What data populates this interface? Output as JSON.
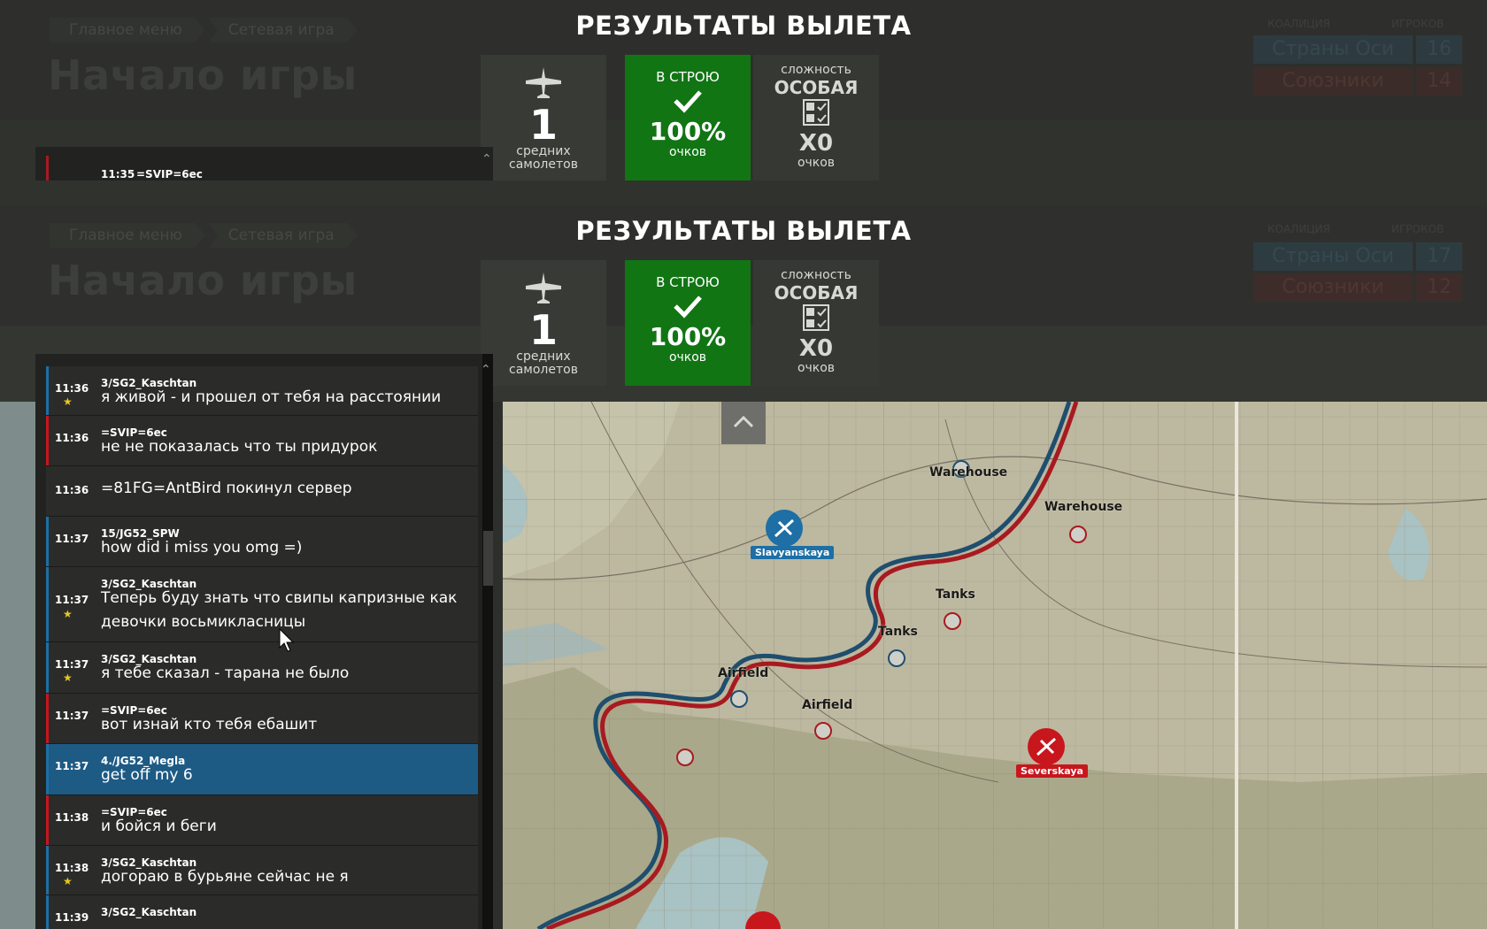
{
  "header": {
    "breadcrumbs": [
      "Главное меню",
      "Сетевая игра"
    ],
    "page_title": "Начало игры",
    "coalition_header": "КОАЛИЦИЯ",
    "players_header": "ИГРОКОВ",
    "ghost_axis": {
      "name": "Страны Оси",
      "count": "16"
    },
    "ghost_allies": {
      "name": "Союзники",
      "count": "14"
    },
    "axis": {
      "name": "Страны Оси",
      "count": "17"
    },
    "allies": {
      "name": "Союзники",
      "count": "12"
    }
  },
  "results": {
    "title": "РЕЗУЛЬТАТЫ ВЫЛЕТА",
    "planes_count": "1",
    "planes_label_1": "средних",
    "planes_label_2": "самолетов",
    "status_label": "В СТРОЮ",
    "status_value": "100%",
    "status_unit": "очков",
    "difficulty_label": "сложность",
    "difficulty_value": "ОСОБАЯ",
    "multiplier": "X0",
    "multiplier_unit": "очков"
  },
  "chat": {
    "ghost": {
      "time": "11:35",
      "sender": "=SVIP=6ec"
    },
    "messages": [
      {
        "time": "11:36",
        "sender": "3/SG2_Kaschtan",
        "text": "я живой - и прошел от тебя на расстоянии",
        "team": "axis",
        "star": true
      },
      {
        "time": "11:36",
        "sender": "=SVIP=6ec",
        "text": "не не показалась что ты придурок",
        "team": "allies",
        "star": false
      },
      {
        "time": "11:36",
        "sender": "",
        "text": "=81FG=AntBird покинул сервер",
        "team": "system",
        "star": false
      },
      {
        "time": "11:37",
        "sender": "15/JG52_SPW",
        "text": "how did i miss you omg =)",
        "team": "axis",
        "star": false
      },
      {
        "time": "11:37",
        "sender": "3/SG2_Kaschtan",
        "text": "Теперь буду знать что свипы капризные как",
        "text2": "девочки восьмикласницы",
        "team": "axis",
        "star": true
      },
      {
        "time": "11:37",
        "sender": "3/SG2_Kaschtan",
        "text": "я тебе сказал - тарана не было",
        "team": "axis",
        "star": true
      },
      {
        "time": "11:37",
        "sender": "=SVIP=6ec",
        "text": "вот изнай кто тебя ебашит",
        "team": "allies",
        "star": false
      },
      {
        "time": "11:37",
        "sender": "4./JG52_Megla",
        "text": "get off my 6",
        "team": "axis",
        "star": false
      },
      {
        "time": "11:38",
        "sender": "=SVIP=6ec",
        "text": "и бойся и беги",
        "team": "allies",
        "star": false
      },
      {
        "time": "11:38",
        "sender": "3/SG2_Kaschtan",
        "text": "догораю в бурьяне сейчас не я",
        "team": "axis",
        "star": true
      },
      {
        "time": "11:39",
        "sender": "3/SG2_Kaschtan",
        "text": "",
        "team": "axis",
        "star": false
      }
    ]
  },
  "map": {
    "labels": {
      "warehouse_1": "Warehouse",
      "warehouse_2": "Warehouse",
      "tanks_1": "Tanks",
      "tanks_2": "Tanks",
      "airfield_1": "Airfield",
      "airfield_2": "Airfield",
      "slavyanskaya": "Slavyanskaya",
      "severskaya": "Severskaya"
    },
    "colors": {
      "axis": "#1d6fa5",
      "allies": "#c8161d",
      "front_blue": "#1f4e6e",
      "front_red": "#a81a20"
    }
  },
  "icons": [
    "plane-icon",
    "check-icon",
    "difficulty-icon",
    "chevron-up-icon",
    "star-icon",
    "mouse-cursor-icon"
  ]
}
